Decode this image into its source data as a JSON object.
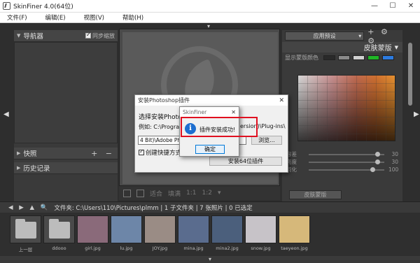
{
  "window": {
    "title": "SkinFiner 4.0(64位)",
    "minimize": "—",
    "maximize": "☐",
    "close": "✕"
  },
  "menu": [
    "文件(F)",
    "编辑(E)",
    "视图(V)",
    "帮助(H)"
  ],
  "left_panel": {
    "navigator": "导航器",
    "sync_label": "同步缩放",
    "snapshot": "快照",
    "history": "历史记录",
    "plus_minus": "+ −"
  },
  "right_panel": {
    "preset": "应用预设",
    "preset_icons": "+ ⚙ ⚙",
    "skin_mask": "皮肤蒙版",
    "skin_mask_arrow": "▼",
    "mask_color_label": "显示蒙版颜色",
    "swatches": [
      "#2a2a2a",
      "#8a8a8a",
      "#d0d0d0",
      "#1fb526",
      "#2c7be0"
    ],
    "sliders": [
      {
        "label": "容差",
        "value": "30",
        "level": 0.92
      },
      {
        "label": "亮度",
        "value": "30",
        "level": 0.92
      },
      {
        "label": "羽化",
        "value": "100",
        "level": 0.85
      }
    ],
    "mask_button": "皮肤蒙版"
  },
  "center_toolbar": [
    "适合",
    "填满",
    "1:1",
    "1:2",
    "▾"
  ],
  "filebar": {
    "nav": "◀ ▶ ▲ 🔍",
    "text": "文件夹: C:\\Users\\110\\Pictures\\plmm | 1 子文件夹 | 7 张照片 | 0 已选定"
  },
  "thumbnails": [
    {
      "label": "上一层",
      "kind": "up",
      "color": "#bcbcbc"
    },
    {
      "label": "ddooo",
      "kind": "folder",
      "color": "#bcbcbc"
    },
    {
      "label": "girl.jpg",
      "kind": "photo",
      "color": "#8a6a7a"
    },
    {
      "label": "lu.jpg",
      "kind": "photo",
      "color": "#6d86a8"
    },
    {
      "label": "JOY.jpg",
      "kind": "photo",
      "color": "#9a8c85"
    },
    {
      "label": "mina.jpg",
      "kind": "photo",
      "color": "#5a6c8e"
    },
    {
      "label": "mina2.jpg",
      "kind": "photo",
      "color": "#4b5f7c"
    },
    {
      "label": "snow.jpg",
      "kind": "photo",
      "color": "#c7c3c8"
    },
    {
      "label": "taeyeon.jpg",
      "kind": "photo",
      "color": "#d6b87a"
    }
  ],
  "install_dialog": {
    "title": "安装Photoshop插件",
    "close": "✕",
    "choose": "选择安装Photoshop",
    "example_prefix": "例如: C:\\Program",
    "example_suffix": "ersion)\\Plug-ins\\",
    "path_value": "4 Bit)\\Adobe Phot",
    "browse": "浏览...",
    "shortcut": "创建快捷方式",
    "install64": "安装64位插件"
  },
  "message_box": {
    "title": "SkinFiner",
    "close": "✕",
    "icon": "i",
    "text": "插件安装成功!",
    "ok": "确定"
  }
}
